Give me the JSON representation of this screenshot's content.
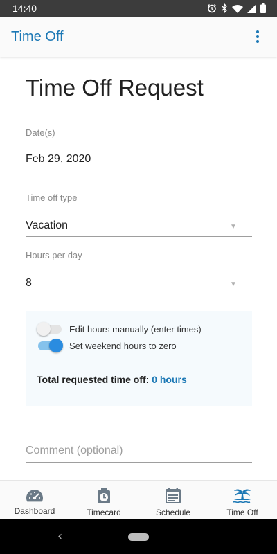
{
  "status_bar": {
    "time": "14:40",
    "icons": [
      "alarm-icon",
      "bluetooth-icon",
      "wifi-icon",
      "signal-icon",
      "battery-icon"
    ]
  },
  "app_bar": {
    "title": "Time Off",
    "menu_icon": "more-vert-icon"
  },
  "form": {
    "heading": "Time Off Request",
    "dates_label": "Date(s)",
    "dates_value": "Feb 29, 2020",
    "type_label": "Time off type",
    "type_value": "Vacation",
    "hours_label": "Hours per day",
    "hours_value": "8",
    "caret": "▼"
  },
  "options": {
    "edit_manually": {
      "label": "Edit hours manually (enter times)",
      "checked": false
    },
    "weekend_zero": {
      "label": "Set weekend hours to zero",
      "checked": true
    },
    "total_label": "Total requested time off:",
    "total_value": "0 hours"
  },
  "comment": {
    "placeholder": "Comment (optional)"
  },
  "bottom_nav": {
    "items": [
      {
        "label": "Dashboard",
        "icon": "speedometer-icon",
        "active": false
      },
      {
        "label": "Timecard",
        "icon": "timer-icon",
        "active": false
      },
      {
        "label": "Schedule",
        "icon": "calendar-icon",
        "active": false
      },
      {
        "label": "Time Off",
        "icon": "palm-island-icon",
        "active": true
      }
    ]
  },
  "colors": {
    "accent": "#1c78b5",
    "toggle_on": "#2a8ce0",
    "card_bg": "#f5fafd"
  }
}
